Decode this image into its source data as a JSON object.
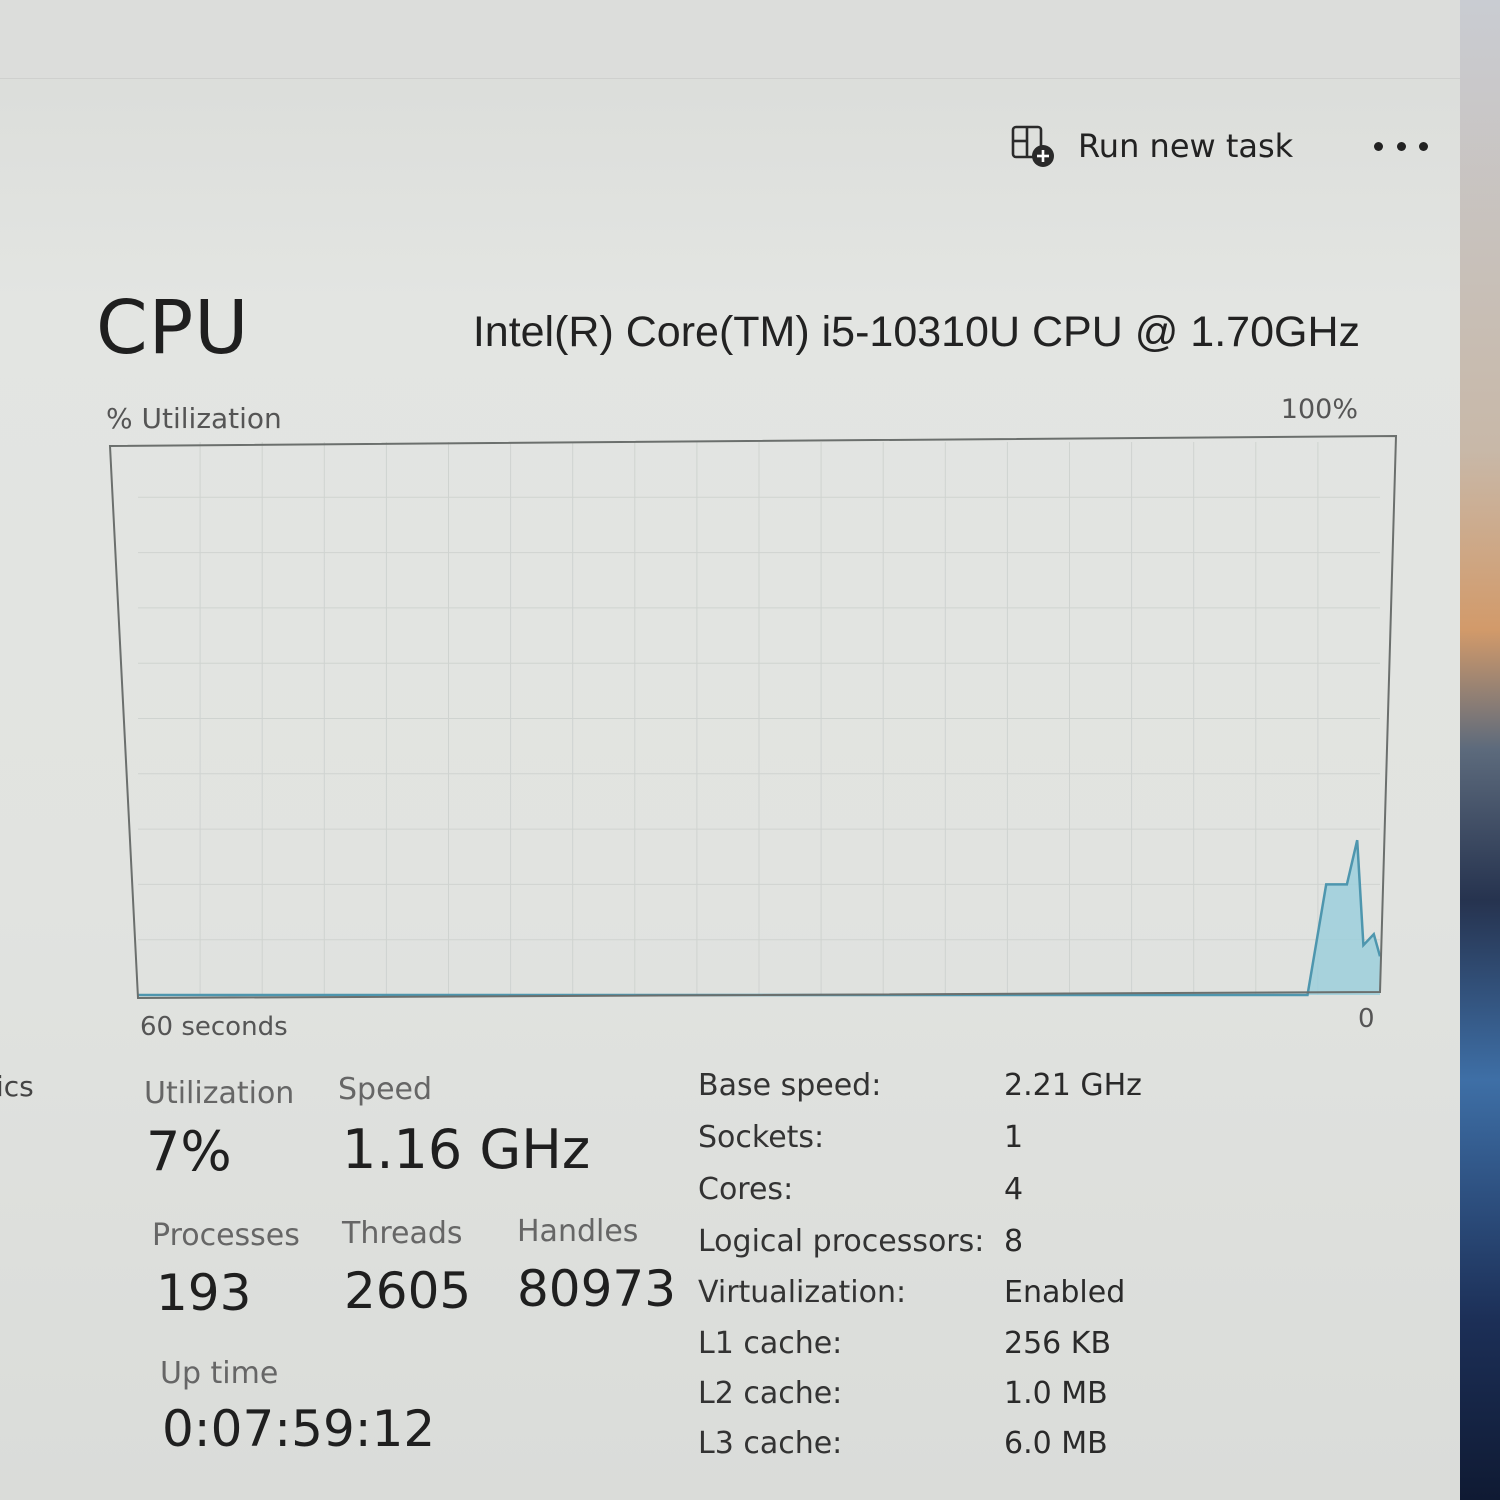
{
  "toolbar": {
    "run_new_task_label": "Run new task",
    "run_new_task_icon": "run-task-icon",
    "more_icon": "more-options-icon"
  },
  "header": {
    "title": "CPU",
    "model": "Intel(R) Core(TM) i5-10310U CPU @ 1.70GHz"
  },
  "sidebar_fragment": "ics",
  "chart_data": {
    "type": "area",
    "ylabel": "% Utilization",
    "y_max_label": "100%",
    "x_start_label": "60 seconds",
    "x_end_label": "0",
    "xlim": [
      60,
      0
    ],
    "ylim": [
      0,
      100
    ],
    "grid": true,
    "line_color": "#4e96ae",
    "fill_color": "#9ccfdc",
    "x": [
      60,
      3.5,
      2.6,
      1.6,
      1.1,
      0.8,
      0.3,
      0
    ],
    "y": [
      0,
      0,
      20,
      20,
      28,
      9,
      11,
      7
    ]
  },
  "stats": {
    "utilization": {
      "label": "Utilization",
      "value": "7%"
    },
    "speed": {
      "label": "Speed",
      "value": "1.16 GHz"
    },
    "processes": {
      "label": "Processes",
      "value": "193"
    },
    "threads": {
      "label": "Threads",
      "value": "2605"
    },
    "handles": {
      "label": "Handles",
      "value": "80973"
    },
    "uptime": {
      "label": "Up time",
      "value": "0:07:59:12"
    }
  },
  "specs": [
    {
      "key": "Base speed:",
      "value": "2.21 GHz"
    },
    {
      "key": "Sockets:",
      "value": "1"
    },
    {
      "key": "Cores:",
      "value": "4"
    },
    {
      "key": "Logical processors:",
      "value": "8"
    },
    {
      "key": "Virtualization:",
      "value": "Enabled"
    },
    {
      "key": "L1 cache:",
      "value": "256 KB"
    },
    {
      "key": "L2 cache:",
      "value": "1.0 MB"
    },
    {
      "key": "L3 cache:",
      "value": "6.0 MB"
    }
  ]
}
